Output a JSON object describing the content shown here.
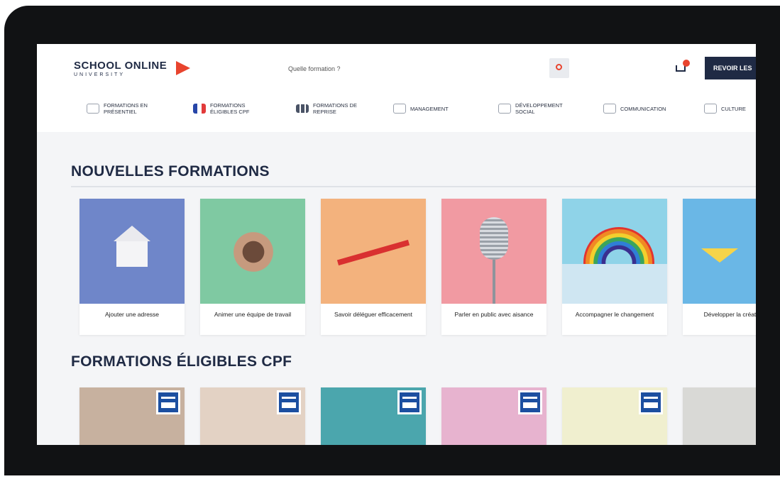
{
  "header": {
    "logo_title": "SCHOOL ONLINE",
    "logo_subtitle": "UNIVERSITY",
    "search_placeholder": "Quelle formation ?",
    "cta_label": "REVOIR LES"
  },
  "category_nav": [
    {
      "label": "FORMATIONS EN PRÉSENTIEL",
      "icon": "people-icon"
    },
    {
      "label": "FORMATIONS ÉLIGIBLES CPF",
      "icon": "flag-icon"
    },
    {
      "label": "FORMATIONS DE REPRISE",
      "icon": "grid-icon"
    },
    {
      "label": "MANAGEMENT",
      "icon": "chart-icon"
    },
    {
      "label": "DÉVELOPPEMENT SOCIAL",
      "icon": "handshake-icon"
    },
    {
      "label": "COMMUNICATION",
      "icon": "chat-icon"
    },
    {
      "label": "CULTURE",
      "icon": "book-icon"
    }
  ],
  "sections": {
    "new_title": "NOUVELLES FORMATIONS",
    "cpf_title": "FORMATIONS ÉLIGIBLES CPF"
  },
  "new_courses": [
    {
      "caption": "Ajouter une adresse",
      "color": "#6f86c9"
    },
    {
      "caption": "Animer une équipe de travail",
      "color": "#7fc9a2"
    },
    {
      "caption": "Savoir déléguer efficacement",
      "color": "#f3b27d"
    },
    {
      "caption": "Parler en public avec aisance",
      "color": "#f19aa2"
    },
    {
      "caption": "Accompagner le changement",
      "color": "#8fd3e8"
    },
    {
      "caption": "Développer la créativité",
      "color": "#6ab7e6"
    }
  ],
  "cpf_courses": [
    {
      "color": "#c7b19f"
    },
    {
      "color": "#e3d2c4"
    },
    {
      "color": "#4ba6ad"
    },
    {
      "color": "#e7b3cf"
    },
    {
      "color": "#f0efcf"
    },
    {
      "color": "#d9d9d6"
    }
  ],
  "colors": {
    "brand_navy": "#1f2a44",
    "brand_orange": "#e8442e",
    "cpf_blue": "#1c4fa0"
  }
}
